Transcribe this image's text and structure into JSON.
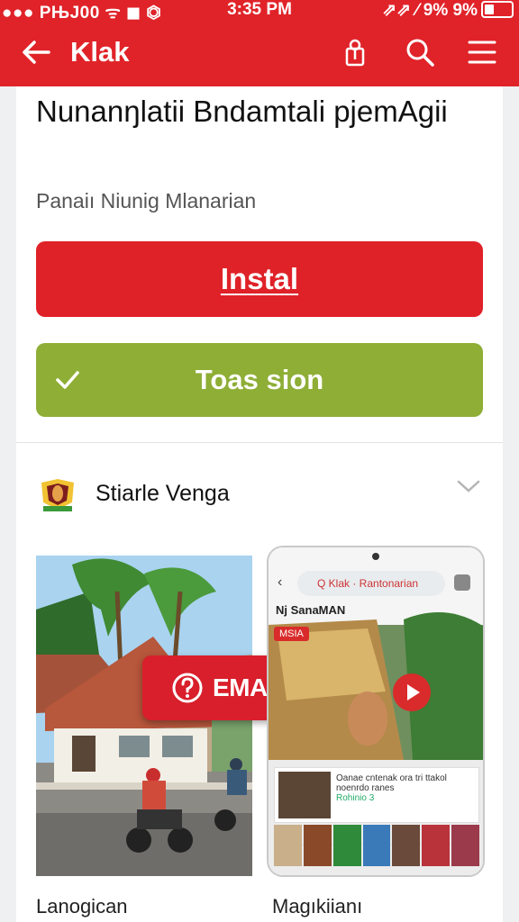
{
  "status_bar": {
    "left": "●●● PЊJ00 ᯤ ◼ ⏣",
    "time": "3:35 PM",
    "right": "⇗⇗ ⁄ 9% 9%"
  },
  "app_bar": {
    "title": "Klak"
  },
  "listing": {
    "headline": "Nunanŋlatii Bndamtali pjemAgii",
    "subtitle": "Panaiı Niunig Mlanarian",
    "install_label": "Instal",
    "secondary_label": "Toas sion"
  },
  "developer": {
    "name": "Stiarle Venga"
  },
  "screenshots": [
    {
      "caption": "Lanogican",
      "badge_label": "EMA NTIA"
    },
    {
      "caption": "Magıkiianı",
      "search_text": "Q Klak · Rantonarian",
      "header_text": "Nj SanaMAN",
      "tag_text": "MSIA",
      "panel_text": "Oanae cntenak ora tri ttakol noenrdo ranes",
      "panel_link": "Rohinio 3"
    }
  ],
  "colors": {
    "brand": "#e02329",
    "button_red": "#df2228",
    "button_green": "#8eae36"
  }
}
